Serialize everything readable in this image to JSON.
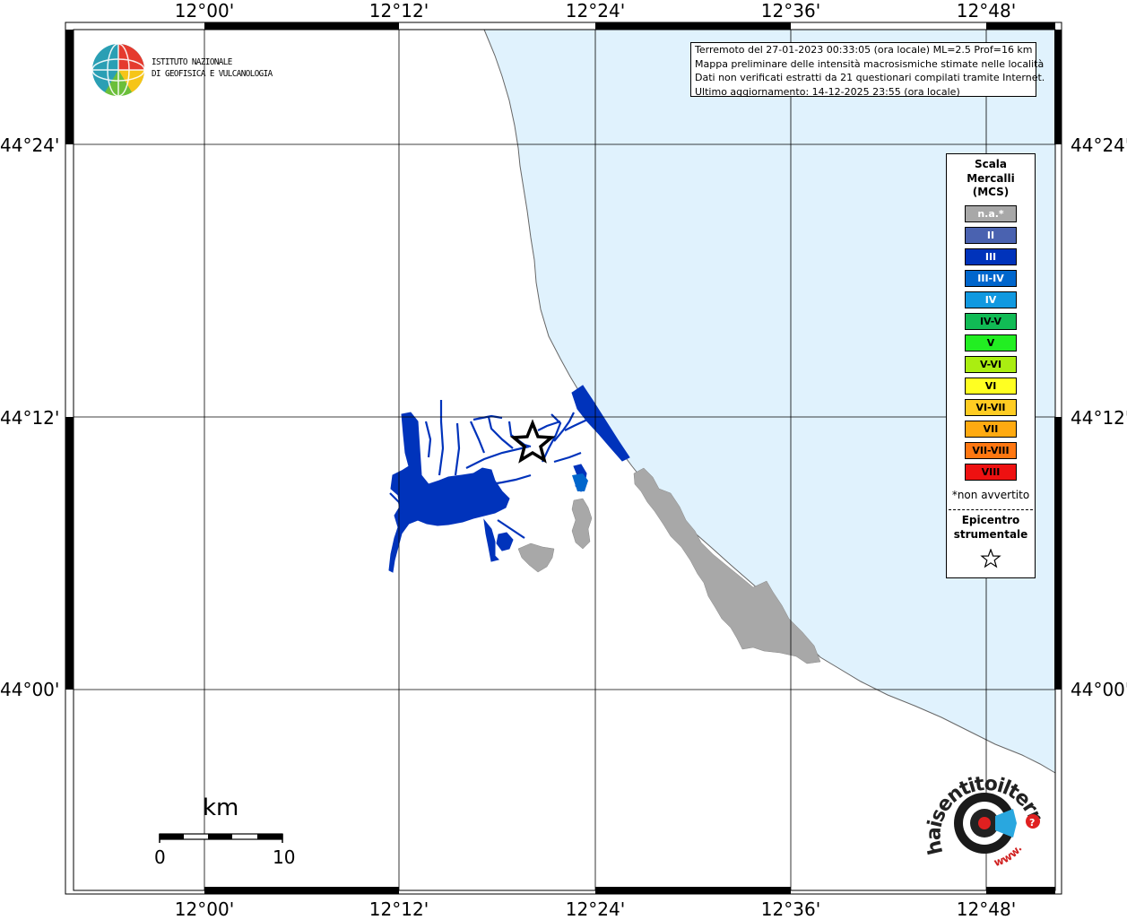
{
  "map": {
    "lon_ticks": [
      "12°00'",
      "12°12'",
      "12°24'",
      "12°36'",
      "12°48'"
    ],
    "lat_ticks": [
      "44°24'",
      "44°12'",
      "44°00'"
    ],
    "colors": {
      "sea": "#e0f2fd",
      "land": "#ffffff",
      "intensity_III": "#0033bb",
      "not_available": "#a8a8a8"
    }
  },
  "info": {
    "line1": "Terremoto del 27-01-2023 00:33:05 (ora locale) ML=2.5 Prof=16 km",
    "line2": "Mappa preliminare delle intensità macrosismiche stimate nelle località",
    "line3": "Dati non verificati estratti da 21 questionari compilati tramite Internet.",
    "line4": "Ultimo aggiornamento: 14-12-2025 23:55 (ora locale)"
  },
  "institute": {
    "line1": "ISTITUTO NAZIONALE",
    "line2": "DI GEOFISICA E VULCANOLOGIA"
  },
  "legend": {
    "title1": "Scala",
    "title2": "Mercalli",
    "title3": "(MCS)",
    "items": [
      {
        "label": "n.a.*",
        "color": "#a8a8a8"
      },
      {
        "label": "II",
        "color": "#4a62b0"
      },
      {
        "label": "III",
        "color": "#0033bb"
      },
      {
        "label": "III-IV",
        "color": "#0066cc"
      },
      {
        "label": "IV",
        "color": "#1199e0"
      },
      {
        "label": "IV-V",
        "color": "#11bb55"
      },
      {
        "label": "V",
        "color": "#22ee22"
      },
      {
        "label": "V-VI",
        "color": "#aaee11"
      },
      {
        "label": "VI",
        "color": "#ffff22"
      },
      {
        "label": "VI-VII",
        "color": "#ffcc22"
      },
      {
        "label": "VII",
        "color": "#ffaa11"
      },
      {
        "label": "VII-VIII",
        "color": "#ff7711"
      },
      {
        "label": "VIII",
        "color": "#ee1111"
      }
    ],
    "note": "*non avvertito",
    "epicenter1": "Epicentro",
    "epicenter2": "strumentale"
  },
  "scale": {
    "unit": "km",
    "min": "0",
    "max": "10"
  },
  "haisentito": {
    "text": "haisentitoilterremoto.it",
    "prefix": "www."
  }
}
